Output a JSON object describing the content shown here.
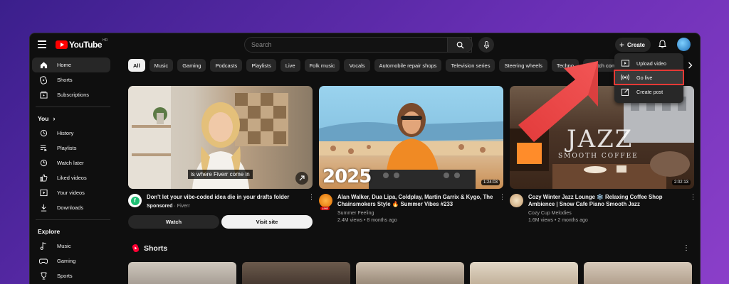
{
  "header": {
    "logo_text": "YouTube",
    "logo_country": "HR",
    "search_placeholder": "Search",
    "create_label": "Create"
  },
  "create_menu": {
    "items": [
      {
        "label": "Upload video",
        "icon": "upload-video-icon"
      },
      {
        "label": "Go live",
        "icon": "go-live-icon"
      },
      {
        "label": "Create post",
        "icon": "create-post-icon"
      }
    ]
  },
  "sidebar": {
    "items": [
      {
        "label": "Home",
        "icon": "home-icon"
      },
      {
        "label": "Shorts",
        "icon": "shorts-icon"
      },
      {
        "label": "Subscriptions",
        "icon": "subscriptions-icon"
      }
    ],
    "you_label": "You",
    "you_items": [
      {
        "label": "History",
        "icon": "history-icon"
      },
      {
        "label": "Playlists",
        "icon": "playlists-icon"
      },
      {
        "label": "Watch later",
        "icon": "watch-later-icon"
      },
      {
        "label": "Liked videos",
        "icon": "liked-videos-icon"
      },
      {
        "label": "Your videos",
        "icon": "your-videos-icon"
      },
      {
        "label": "Downloads",
        "icon": "downloads-icon"
      }
    ],
    "explore_label": "Explore",
    "explore_items": [
      {
        "label": "Music",
        "icon": "music-icon"
      },
      {
        "label": "Gaming",
        "icon": "gaming-icon"
      },
      {
        "label": "Sports",
        "icon": "sports-icon"
      }
    ]
  },
  "chips": [
    "All",
    "Music",
    "Gaming",
    "Podcasts",
    "Playlists",
    "Live",
    "Folk music",
    "Vocals",
    "Automobile repair shops",
    "Television series",
    "Steering wheels",
    "Techno",
    "Sketch come"
  ],
  "videos": [
    {
      "title": "Don't let your vibe-coded idea die in your drafts folder",
      "sponsored": "Sponsored",
      "advertiser": "Fiverr",
      "caption": "is where Fiverr come in",
      "watch_label": "Watch",
      "visit_label": "Visit site"
    },
    {
      "title": "Alan Walker, Dua Lipa, Coldplay, Martin Garrix & Kygo, The Chainsmokers Style 🔥 Summer Vibes #233",
      "channel": "Summer Feeling",
      "stats": "2.4M views • 8 months ago",
      "duration": "1:24:03",
      "overlay_text": "2025",
      "live_badge": "LIVE"
    },
    {
      "title": "Cozy Winter Jazz Lounge ❄️ Relaxing Coffee Shop Ambience | Snow Cafe Piano Smooth Jazz",
      "channel": "Cozy Cup Melodies",
      "stats": "1.6M views • 2 months ago",
      "duration": "2:02:13",
      "overlay_word": "JAZZ",
      "overlay_sub": "SMOOTH COFFEE"
    }
  ],
  "shorts": {
    "title": "Shorts"
  },
  "colors": {
    "accent": "#ff0000",
    "highlight_outline": "#e53935",
    "arrow": "#f04848"
  }
}
